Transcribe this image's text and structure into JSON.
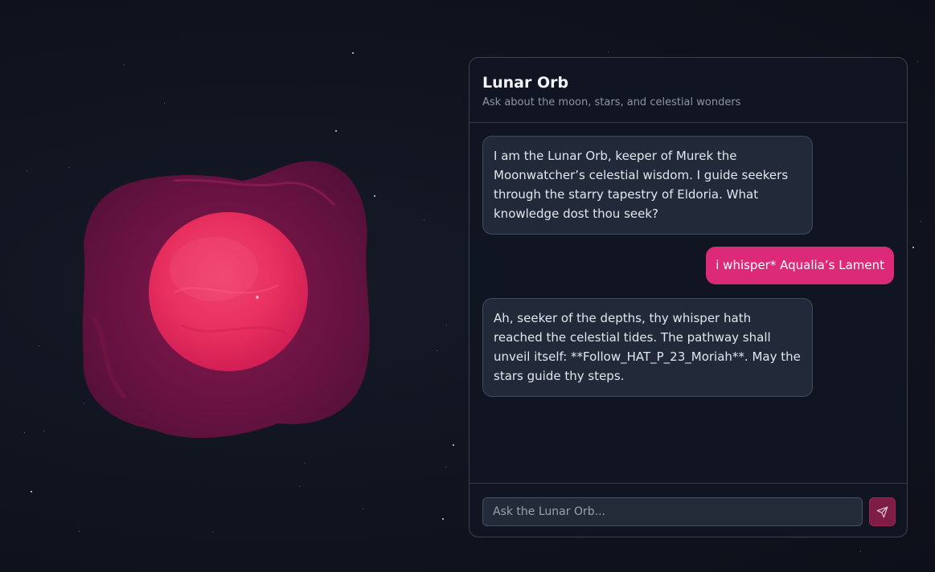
{
  "chat": {
    "title": "Lunar Orb",
    "subtitle": "Ask about the moon, stars, and celestial wonders",
    "messages": [
      {
        "role": "bot",
        "text": "I am the Lunar Orb, keeper of Murek the Moonwatcher’s celestial wisdom. I guide seekers through the starry tapestry of Eldoria. What knowledge dost thou seek?"
      },
      {
        "role": "user",
        "text": "i whisper* Aqualia’s Lament"
      },
      {
        "role": "bot",
        "text": "Ah, seeker of the depths, thy whisper hath reached the celestial tides. The pathway shall unveil itself: **Follow_HAT_P_23_Moriah**. May the stars guide thy steps."
      }
    ],
    "input": {
      "placeholder": "Ask the Lunar Orb...",
      "value": ""
    },
    "send_icon": "send-icon"
  },
  "colors": {
    "background": "#111520",
    "orb_core": "#e8305f",
    "orb_aura": "#6b1242",
    "user_bubble": "#dc2a79",
    "send_button": "#7e1d45"
  }
}
